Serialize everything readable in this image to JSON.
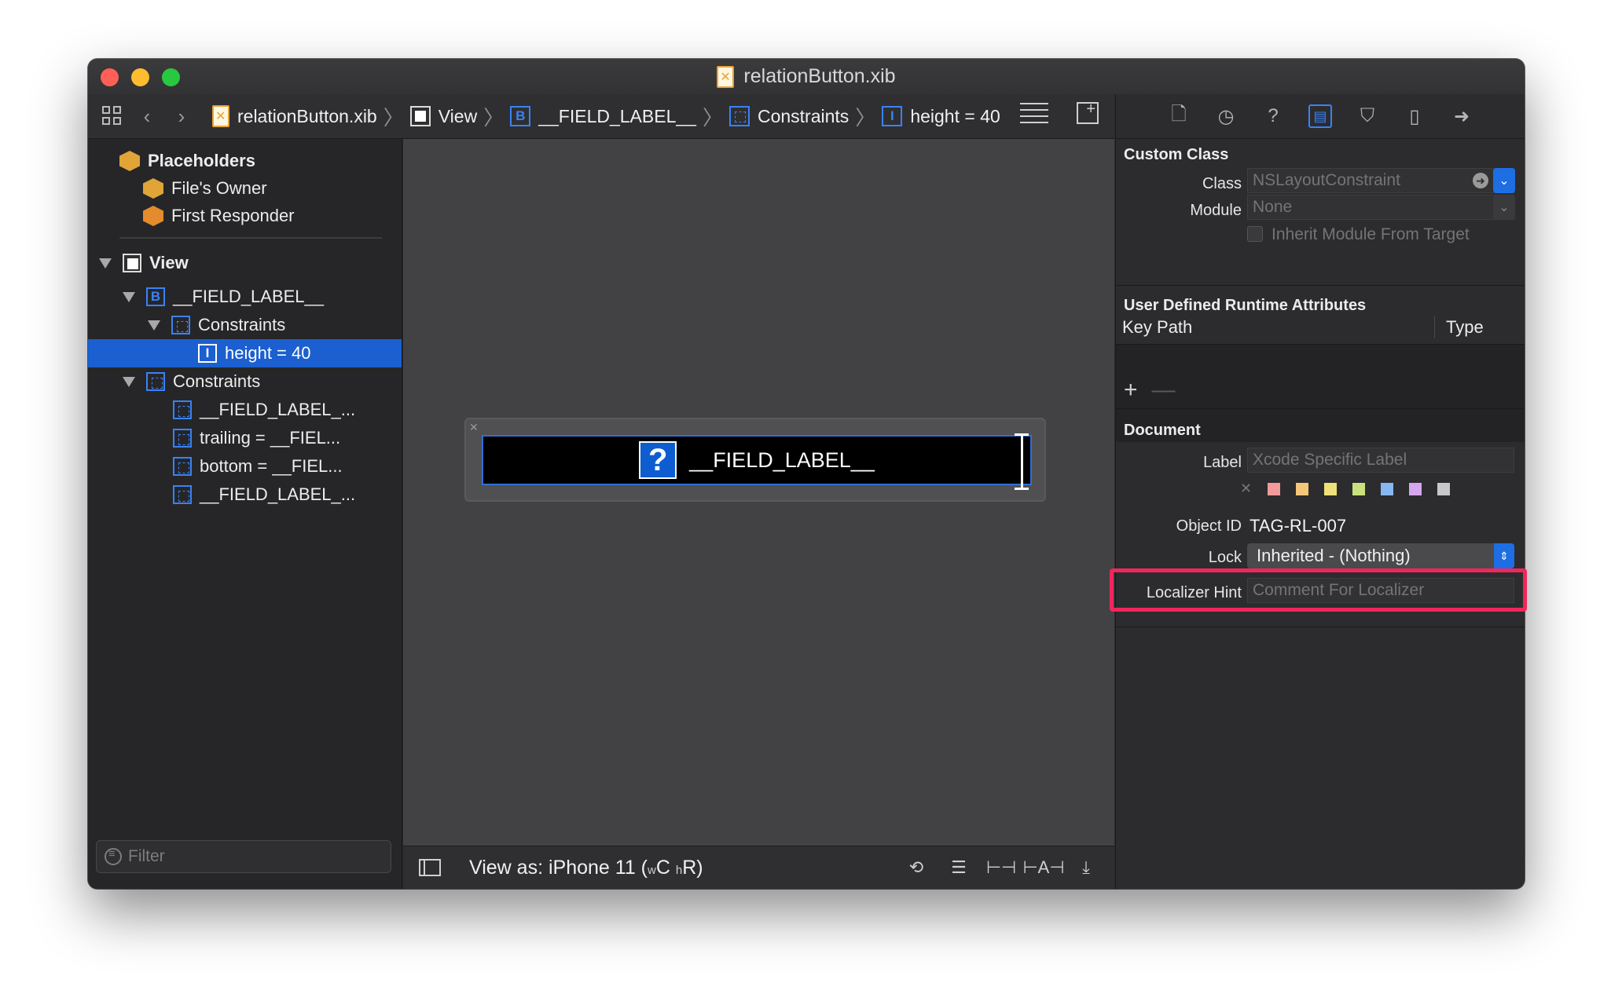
{
  "window": {
    "title": "relationButton.xib"
  },
  "jumpbar": {
    "crumbs": [
      "relationButton.xib",
      "View",
      "__FIELD_LABEL__",
      "Constraints",
      "height = 40"
    ]
  },
  "outline": {
    "placeholders": "Placeholders",
    "files_owner": "File's Owner",
    "first_responder": "First Responder",
    "view": "View",
    "field_label": "__FIELD_LABEL__",
    "constraints_inner": "Constraints",
    "height_item": "height = 40",
    "constraints_outer": "Constraints",
    "constraint_items": [
      "__FIELD_LABEL_...",
      "trailing = __FIEL...",
      "bottom = __FIEL...",
      "__FIELD_LABEL_..."
    ],
    "filter_placeholder": "Filter"
  },
  "canvas": {
    "button_icon": "?",
    "button_label": "__FIELD_LABEL__"
  },
  "bottombar": {
    "view_as": "View as: iPhone 11 (",
    "w": "w",
    "c": "C",
    "h": "h",
    "r": "R)"
  },
  "inspector": {
    "custom_class": {
      "title": "Custom Class",
      "class_label": "Class",
      "class_value": "NSLayoutConstraint",
      "module_label": "Module",
      "module_value": "None",
      "inherit_label": "Inherit Module From Target"
    },
    "runtime_attrs": {
      "title": "User Defined Runtime Attributes",
      "col_key_path": "Key Path",
      "col_type": "Type",
      "plus": "+",
      "minus": "—"
    },
    "document": {
      "title": "Document",
      "label_label": "Label",
      "label_placeholder": "Xcode Specific Label",
      "object_id_label": "Object ID",
      "object_id_value": "TAG-RL-007",
      "lock_label": "Lock",
      "lock_value": "Inherited - (Nothing)",
      "hint_label": "Localizer Hint",
      "hint_placeholder": "Comment For Localizer"
    },
    "swatch_colors": [
      "#f39b9b",
      "#f6c77a",
      "#efe17a",
      "#c9e27d",
      "#86b9f1",
      "#d7a6ee",
      "#c8c8c8"
    ]
  },
  "colors": {
    "selection": "#1b5fd0",
    "highlight": "#f0265d",
    "accent": "#3a82f7"
  }
}
